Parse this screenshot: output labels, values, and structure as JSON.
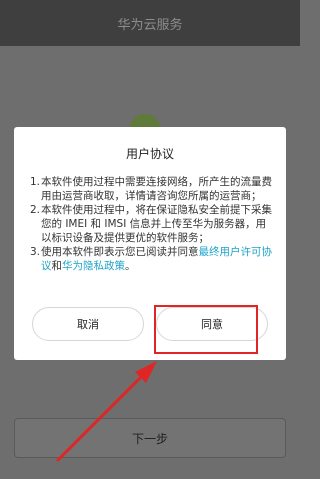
{
  "app": {
    "title": "华为云服务"
  },
  "dialog": {
    "title": "用户协议",
    "terms": {
      "t1": {
        "num": "1.",
        "text": "本软件使用过程中需要连接网络，所产生的流量费用由运营商收取，详情请咨询您所属的运营商；"
      },
      "t2": {
        "num": "2.",
        "text": "本软件使用过程中，将在保证隐私安全前提下采集您的 IMEI 和 IMSI 信息并上传至华为服务器，用以标识设备及提供更优的软件服务；"
      },
      "t3": {
        "num": "3.",
        "prefix": "使用本软件即表示您已阅读并同意",
        "link1": "最终用户许可协议",
        "middle": "和",
        "link2": "华为隐私政策",
        "suffix": "。"
      }
    },
    "cancel_label": "取消",
    "agree_label": "同意"
  },
  "footer": {
    "next_label": "下一步"
  },
  "colors": {
    "link": "#1fa3c8",
    "annotation": "#e02525",
    "overlay": "#6e6e6e",
    "dialog_bg": "#ffffff"
  }
}
